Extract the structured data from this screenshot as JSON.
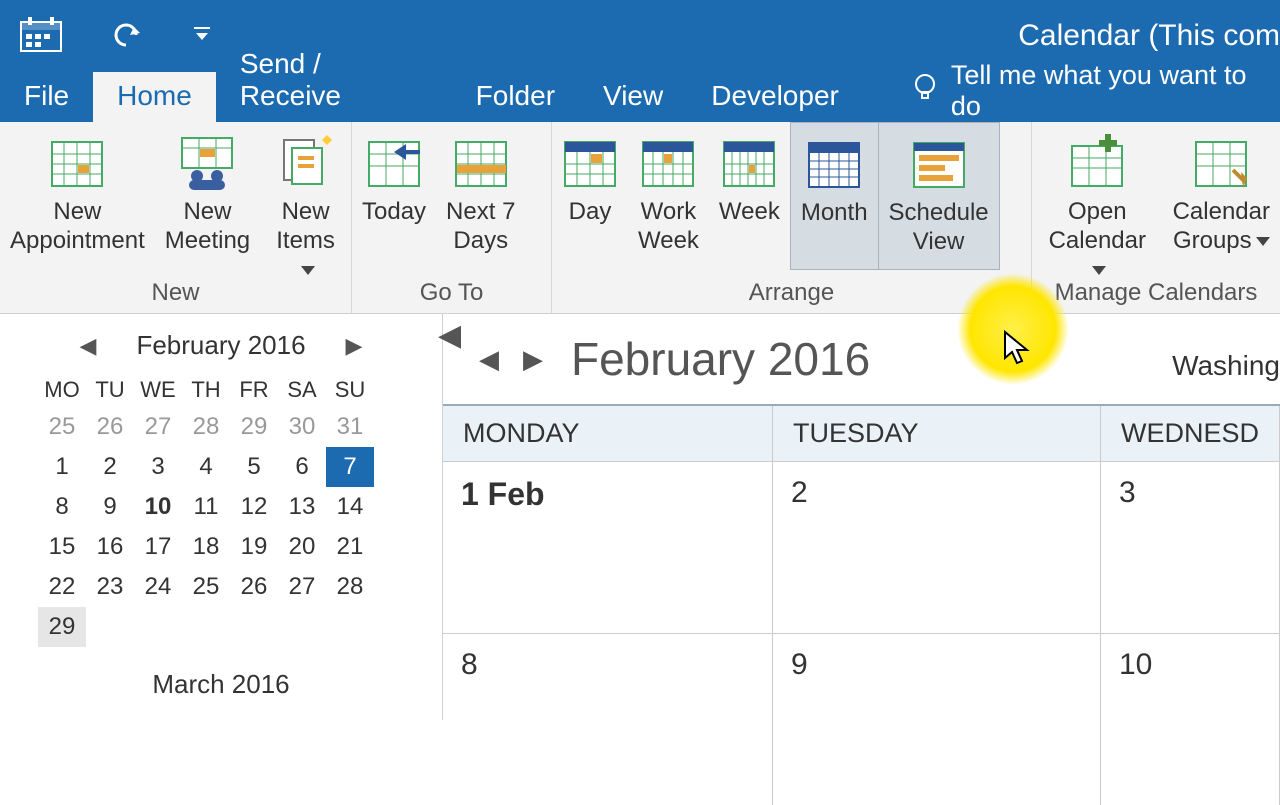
{
  "title": "Calendar (This com",
  "tabs": {
    "file": "File",
    "home": "Home",
    "sendreceive": "Send / Receive",
    "folder": "Folder",
    "view": "View",
    "developer": "Developer"
  },
  "tellme": "Tell me what you want to do",
  "groups": {
    "new": "New",
    "goto": "Go To",
    "arrange": "Arrange",
    "manage": "Manage Calendars"
  },
  "ribbon": {
    "new_appointment": "New\nAppointment",
    "new_meeting": "New\nMeeting",
    "new_items": "New\nItems",
    "today": "Today",
    "next7": "Next 7\nDays",
    "day": "Day",
    "workweek": "Work\nWeek",
    "week": "Week",
    "month": "Month",
    "schedule": "Schedule\nView",
    "open_calendar": "Open\nCalendar",
    "calendar_groups": "Calendar\nGroups"
  },
  "mini": {
    "title": "February 2016",
    "next_title": "March 2016",
    "dows": [
      "MO",
      "TU",
      "WE",
      "TH",
      "FR",
      "SA",
      "SU"
    ],
    "rows": [
      [
        {
          "n": "25",
          "dim": true
        },
        {
          "n": "26",
          "dim": true
        },
        {
          "n": "27",
          "dim": true
        },
        {
          "n": "28",
          "dim": true
        },
        {
          "n": "29",
          "dim": true
        },
        {
          "n": "30",
          "dim": true
        },
        {
          "n": "31",
          "dim": true
        }
      ],
      [
        {
          "n": "1"
        },
        {
          "n": "2"
        },
        {
          "n": "3"
        },
        {
          "n": "4"
        },
        {
          "n": "5"
        },
        {
          "n": "6"
        },
        {
          "n": "7",
          "sel": true
        }
      ],
      [
        {
          "n": "8"
        },
        {
          "n": "9"
        },
        {
          "n": "10",
          "bold": true
        },
        {
          "n": "11"
        },
        {
          "n": "12"
        },
        {
          "n": "13"
        },
        {
          "n": "14"
        }
      ],
      [
        {
          "n": "15"
        },
        {
          "n": "16"
        },
        {
          "n": "17"
        },
        {
          "n": "18"
        },
        {
          "n": "19"
        },
        {
          "n": "20"
        },
        {
          "n": "21"
        }
      ],
      [
        {
          "n": "22"
        },
        {
          "n": "23"
        },
        {
          "n": "24"
        },
        {
          "n": "25"
        },
        {
          "n": "26"
        },
        {
          "n": "27"
        },
        {
          "n": "28"
        }
      ],
      [
        {
          "n": "29",
          "last": true
        },
        {
          "n": ""
        },
        {
          "n": ""
        },
        {
          "n": ""
        },
        {
          "n": ""
        },
        {
          "n": ""
        },
        {
          "n": ""
        }
      ]
    ]
  },
  "view": {
    "title": "February 2016",
    "location": "Washing",
    "cols": [
      "MONDAY",
      "TUESDAY",
      "WEDNESD"
    ],
    "row1": [
      "1 Feb",
      "2",
      "3"
    ],
    "row2": [
      "8",
      "9",
      "10"
    ]
  }
}
